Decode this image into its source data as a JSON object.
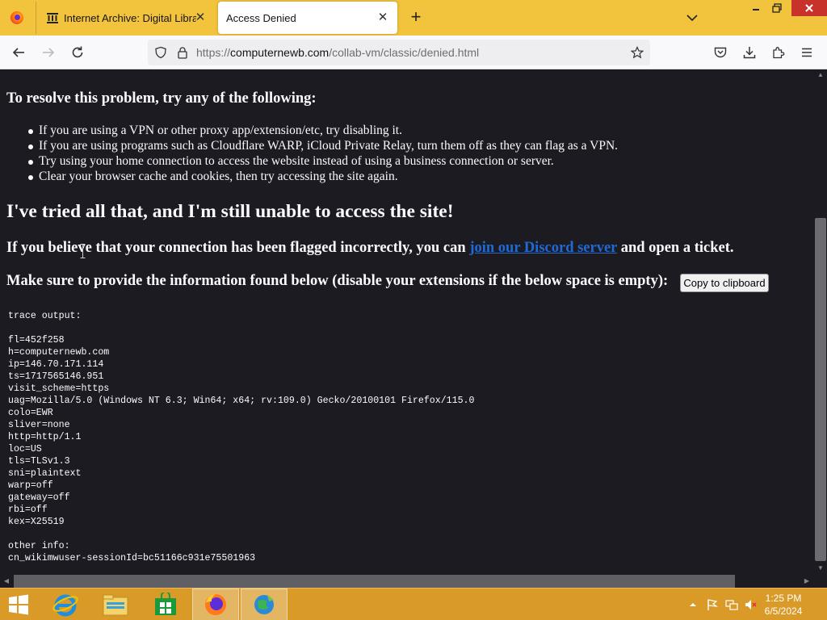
{
  "browser": {
    "tabs": [
      {
        "label": "Internet Archive: Digital Library"
      },
      {
        "label": "Access Denied"
      }
    ],
    "url": {
      "scheme": "https://",
      "host": "computernewb.com",
      "path": "/collab-vm/classic/denied.html"
    }
  },
  "page": {
    "resolve_heading": "To resolve this problem, try any of the following:",
    "tips": [
      "If you are using a VPN or other proxy app/extension/etc, try disabling it.",
      "If you are using programs such as Cloudflare WARP, iCloud Private Relay, turn them off as they can flag as a VPN.",
      "Try using your home connection to access the website instead of using a business connection or server.",
      "Clear your browser cache and cookies, then try accessing the site again."
    ],
    "tried_heading": "I've tried all that, and I'm still unable to access the site!",
    "believe_before": "If you believe that your connection has been flagged incorrectly, you can ",
    "discord_link": "join our Discord server",
    "believe_after": " and open a ticket.",
    "sure_text": "Make sure to provide the information found below (disable your extensions if the below space is empty):",
    "copy_button": "Copy to clipboard",
    "trace_header": "trace output:",
    "trace_lines": [
      "fl=452f258",
      "h=computernewb.com",
      "ip=146.70.171.114",
      "ts=1717565146.951",
      "visit_scheme=https",
      "uag=Mozilla/5.0 (Windows NT 6.3; Win64; x64; rv:109.0) Gecko/20100101 Firefox/115.0",
      "colo=EWR",
      "sliver=none",
      "http=http/1.1",
      "loc=US",
      "tls=TLSv1.3",
      "sni=plaintext",
      "warp=off",
      "gateway=off",
      "rbi=off",
      "kex=X25519"
    ],
    "other_header": "other info:",
    "other_lines": [
      "cn_wikimwuser-sessionId=bc51166c931e75501963"
    ]
  },
  "taskbar": {
    "time": "1:25 PM",
    "date": "6/5/2024"
  },
  "colors": {
    "tabstrip": "#f2c33d",
    "page_bg": "#1c1b22",
    "link": "#1f6ad7",
    "taskbar": "#d99a27"
  }
}
